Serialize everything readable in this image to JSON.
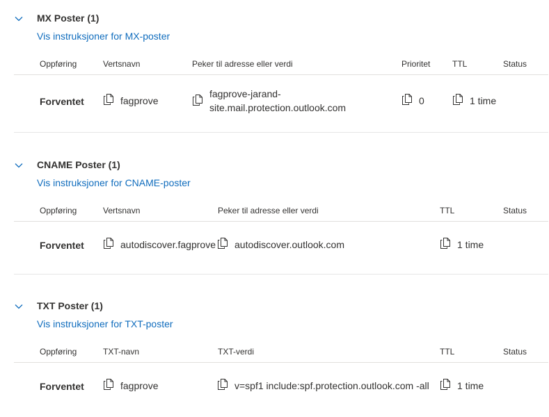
{
  "mx": {
    "title": "MX Poster (1)",
    "link": "Vis instruksjoner for MX-poster",
    "headers": {
      "entry": "Oppføring",
      "host": "Vertsnavn",
      "target": "Peker til adresse eller verdi",
      "priority": "Prioritet",
      "ttl": "TTL",
      "status": "Status"
    },
    "row": {
      "entry": "Forventet",
      "host": "fagprove",
      "target": "fagprove-jarand-site.mail.protection.outlook.com",
      "priority": "0",
      "ttl": "1 time",
      "status": ""
    }
  },
  "cname": {
    "title": "CNAME Poster (1)",
    "link": "Vis instruksjoner for CNAME-poster",
    "headers": {
      "entry": "Oppføring",
      "host": "Vertsnavn",
      "target": "Peker til adresse eller verdi",
      "ttl": "TTL",
      "status": "Status"
    },
    "row": {
      "entry": "Forventet",
      "host": "autodiscover.fagprove",
      "target": "autodiscover.outlook.com",
      "ttl": "1 time",
      "status": ""
    }
  },
  "txt": {
    "title": "TXT Poster (1)",
    "link": "Vis instruksjoner for TXT-poster",
    "headers": {
      "entry": "Oppføring",
      "name": "TXT-navn",
      "value": "TXT-verdi",
      "ttl": "TTL",
      "status": "Status"
    },
    "row": {
      "entry": "Forventet",
      "name": "fagprove",
      "value": "v=spf1 include:spf.protection.outlook.com -all",
      "ttl": "1 time",
      "status": ""
    }
  },
  "icons": {
    "collapse": "chevron-down-icon",
    "copy": "copy-icon"
  },
  "colors": {
    "link": "#0f6cbd",
    "text": "#323130",
    "divider": "#e1dfdd"
  }
}
